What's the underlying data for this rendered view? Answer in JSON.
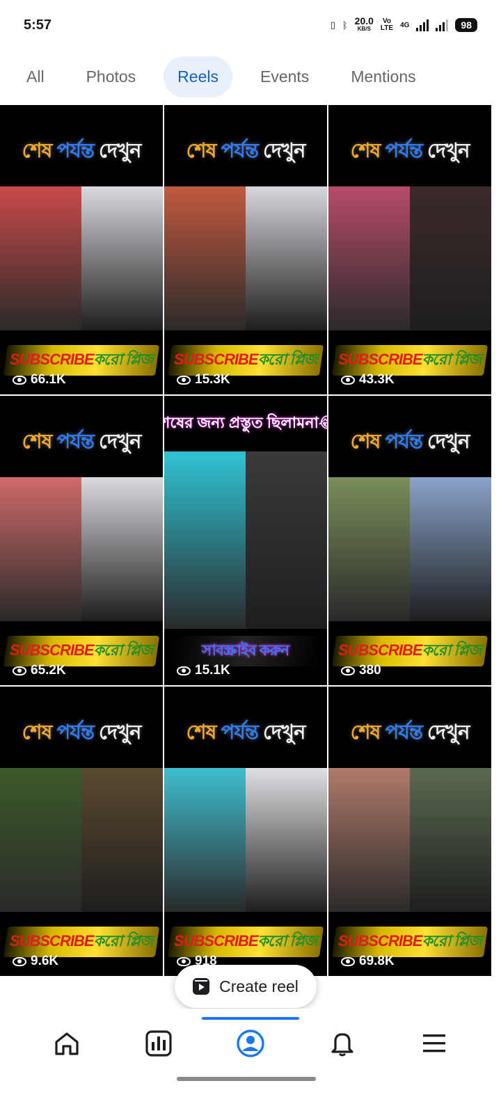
{
  "status": {
    "time": "5:57",
    "speed_value": "20.0",
    "speed_unit": "KB/S",
    "volte_top": "Vo",
    "volte_bottom": "LTE",
    "network": "4G",
    "battery": "98"
  },
  "tabs": [
    {
      "label": "All",
      "active": false
    },
    {
      "label": "Photos",
      "active": false
    },
    {
      "label": "Reels",
      "active": true
    },
    {
      "label": "Events",
      "active": false
    },
    {
      "label": "Mentions",
      "active": false
    }
  ],
  "reels": [
    {
      "title_a": "শেষ",
      "title_b": "পর্যন্ত",
      "title_c": "দেখুন",
      "sub_a": "SUBSCRIBE",
      "sub_b": "করো প্লিজ",
      "views": "66.1K"
    },
    {
      "title_a": "শেষ",
      "title_b": "পর্যন্ত",
      "title_c": "দেখুন",
      "sub_a": "SUBSCRIBE",
      "sub_b": "করো প্লিজ",
      "views": "15.3K"
    },
    {
      "title_a": "শেষ",
      "title_b": "পর্যন্ত",
      "title_c": "দেখুন",
      "sub_a": "SUBSCRIBE",
      "sub_b": "করো প্লিজ",
      "views": "43.3K"
    },
    {
      "title_a": "শেষ",
      "title_b": "পর্যন্ত",
      "title_c": "দেখুন",
      "sub_a": "SUBSCRIBE",
      "sub_b": "করো প্লিজ",
      "views": "65.2K"
    },
    {
      "alt_title": "শেষের জন্য প্রস্তুত ছিলামনা😂",
      "alt_sub": "সাবস্ক্রাইব করুন",
      "views": "15.1K"
    },
    {
      "title_a": "শেষ",
      "title_b": "পর্যন্ত",
      "title_c": "দেখুন",
      "sub_a": "SUBSCRIBE",
      "sub_b": "করো প্লিজ",
      "views": "380"
    },
    {
      "title_a": "শেষ",
      "title_b": "পর্যন্ত",
      "title_c": "দেখুন",
      "sub_a": "SUBSCRIBE",
      "sub_b": "করো প্লিজ",
      "views": "9.6K"
    },
    {
      "title_a": "শেষ",
      "title_b": "পর্যন্ত",
      "title_c": "দেখুন",
      "sub_a": "SUBSCRIBE",
      "sub_b": "করো প্লিজ",
      "views": "918"
    },
    {
      "title_a": "শেষ",
      "title_b": "পর্যন্ত",
      "title_c": "দেখুন",
      "sub_a": "SUBSCRIBE",
      "sub_b": "করো প্লিজ",
      "views": "69.8K"
    }
  ],
  "create_reel": {
    "label": "Create reel",
    "icon": "reel-icon"
  },
  "bottom_nav": [
    {
      "icon": "home-icon"
    },
    {
      "icon": "dashboard-icon"
    },
    {
      "icon": "profile-icon",
      "active": true
    },
    {
      "icon": "bell-icon"
    },
    {
      "icon": "menu-icon"
    }
  ],
  "colors": {
    "accent": "#1877f2",
    "tab_active_bg": "#e7f0fb",
    "tab_active_text": "#1561c8"
  }
}
